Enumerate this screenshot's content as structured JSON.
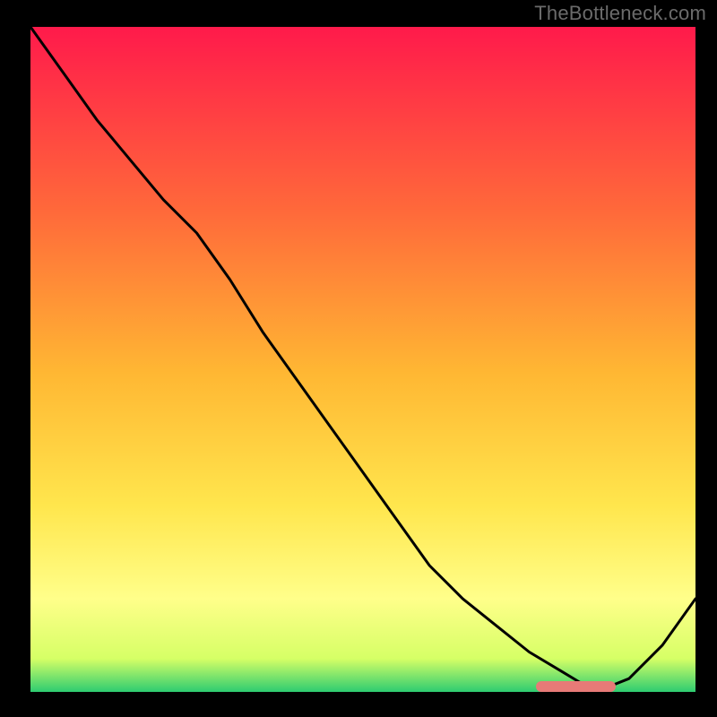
{
  "attribution": "TheBottleneck.com",
  "colors": {
    "frame_bg": "#000000",
    "gradient_top": "#ff1a4b",
    "gradient_mid1": "#ff7a33",
    "gradient_mid2": "#ffd633",
    "gradient_mid3": "#ffff66",
    "gradient_bottom": "#2ecc71",
    "line": "#000000",
    "marker": "#e77a77"
  },
  "chart_data": {
    "type": "line",
    "title": "",
    "xlabel": "",
    "ylabel": "",
    "xlim": [
      0,
      100
    ],
    "ylim": [
      0,
      100
    ],
    "grid": false,
    "series": [
      {
        "name": "curve",
        "x": [
          0,
          5,
          10,
          15,
          20,
          25,
          30,
          35,
          40,
          45,
          50,
          55,
          60,
          65,
          70,
          75,
          80,
          83,
          86,
          90,
          95,
          100
        ],
        "y": [
          100,
          93,
          86,
          80,
          74,
          69,
          62,
          54,
          47,
          40,
          33,
          26,
          19,
          14,
          10,
          6,
          3,
          1.2,
          0.4,
          2,
          7,
          14
        ]
      }
    ],
    "annotations": [
      {
        "name": "optimal-marker",
        "x_start": 76,
        "x_end": 88,
        "y": 0.8
      }
    ],
    "gradient_stops": [
      {
        "offset": 0.0,
        "color": "#ff1a4b"
      },
      {
        "offset": 0.28,
        "color": "#ff6a3a"
      },
      {
        "offset": 0.52,
        "color": "#ffb733"
      },
      {
        "offset": 0.72,
        "color": "#ffe64d"
      },
      {
        "offset": 0.86,
        "color": "#ffff8a"
      },
      {
        "offset": 0.95,
        "color": "#d6ff66"
      },
      {
        "offset": 1.0,
        "color": "#2ecc71"
      }
    ]
  }
}
